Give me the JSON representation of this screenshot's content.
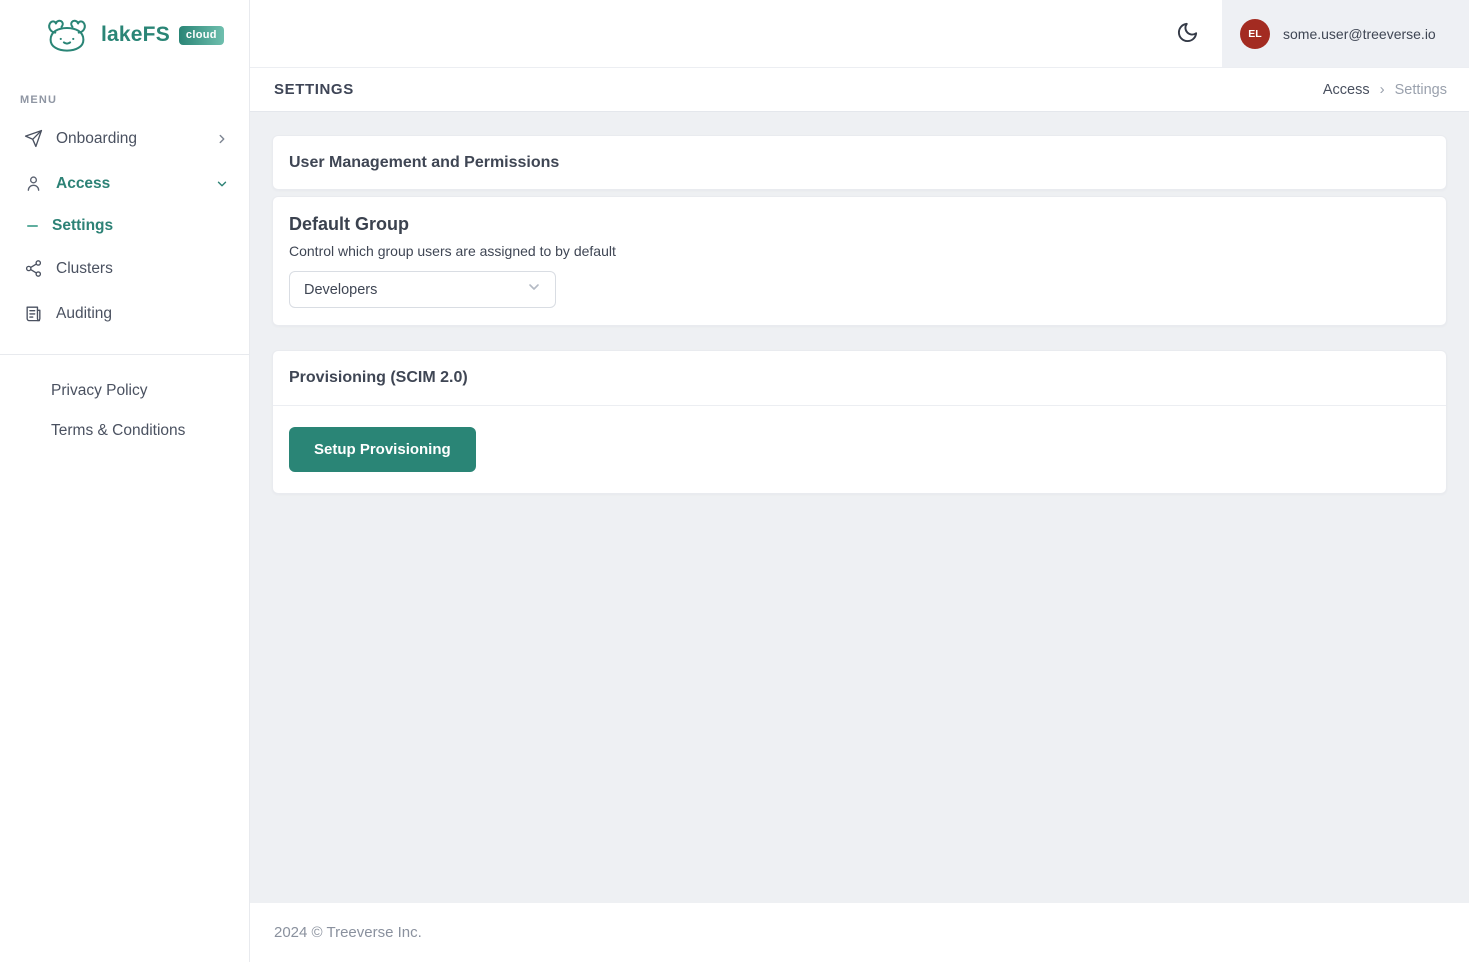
{
  "brand": {
    "name": "lakeFS",
    "badge": "cloud"
  },
  "sidebar": {
    "menu_label": "MENU",
    "items": [
      {
        "label": "Onboarding"
      },
      {
        "label": "Access"
      },
      {
        "label": "Settings"
      },
      {
        "label": "Clusters"
      },
      {
        "label": "Auditing"
      }
    ],
    "footer_links": [
      {
        "label": "Privacy Policy"
      },
      {
        "label": "Terms & Conditions"
      }
    ]
  },
  "header": {
    "user": {
      "initials": "EL",
      "email": "some.user@treeverse.io"
    }
  },
  "page": {
    "title": "SETTINGS",
    "breadcrumb": {
      "parent": "Access",
      "separator": "›",
      "current": "Settings"
    }
  },
  "sections": {
    "user_management": {
      "title": "User Management and Permissions"
    },
    "default_group": {
      "title": "Default Group",
      "description": "Control which group users are assigned to by default",
      "selected_option": "Developers"
    },
    "provisioning": {
      "title": "Provisioning (SCIM 2.0)",
      "button_label": "Setup Provisioning"
    }
  },
  "footer": {
    "copyright": "2024 © Treeverse Inc."
  },
  "colors": {
    "accent_teal": "#2a8576",
    "avatar_red": "#a32b21",
    "content_background": "#eef0f3",
    "panel_background": "#eef0f4"
  }
}
